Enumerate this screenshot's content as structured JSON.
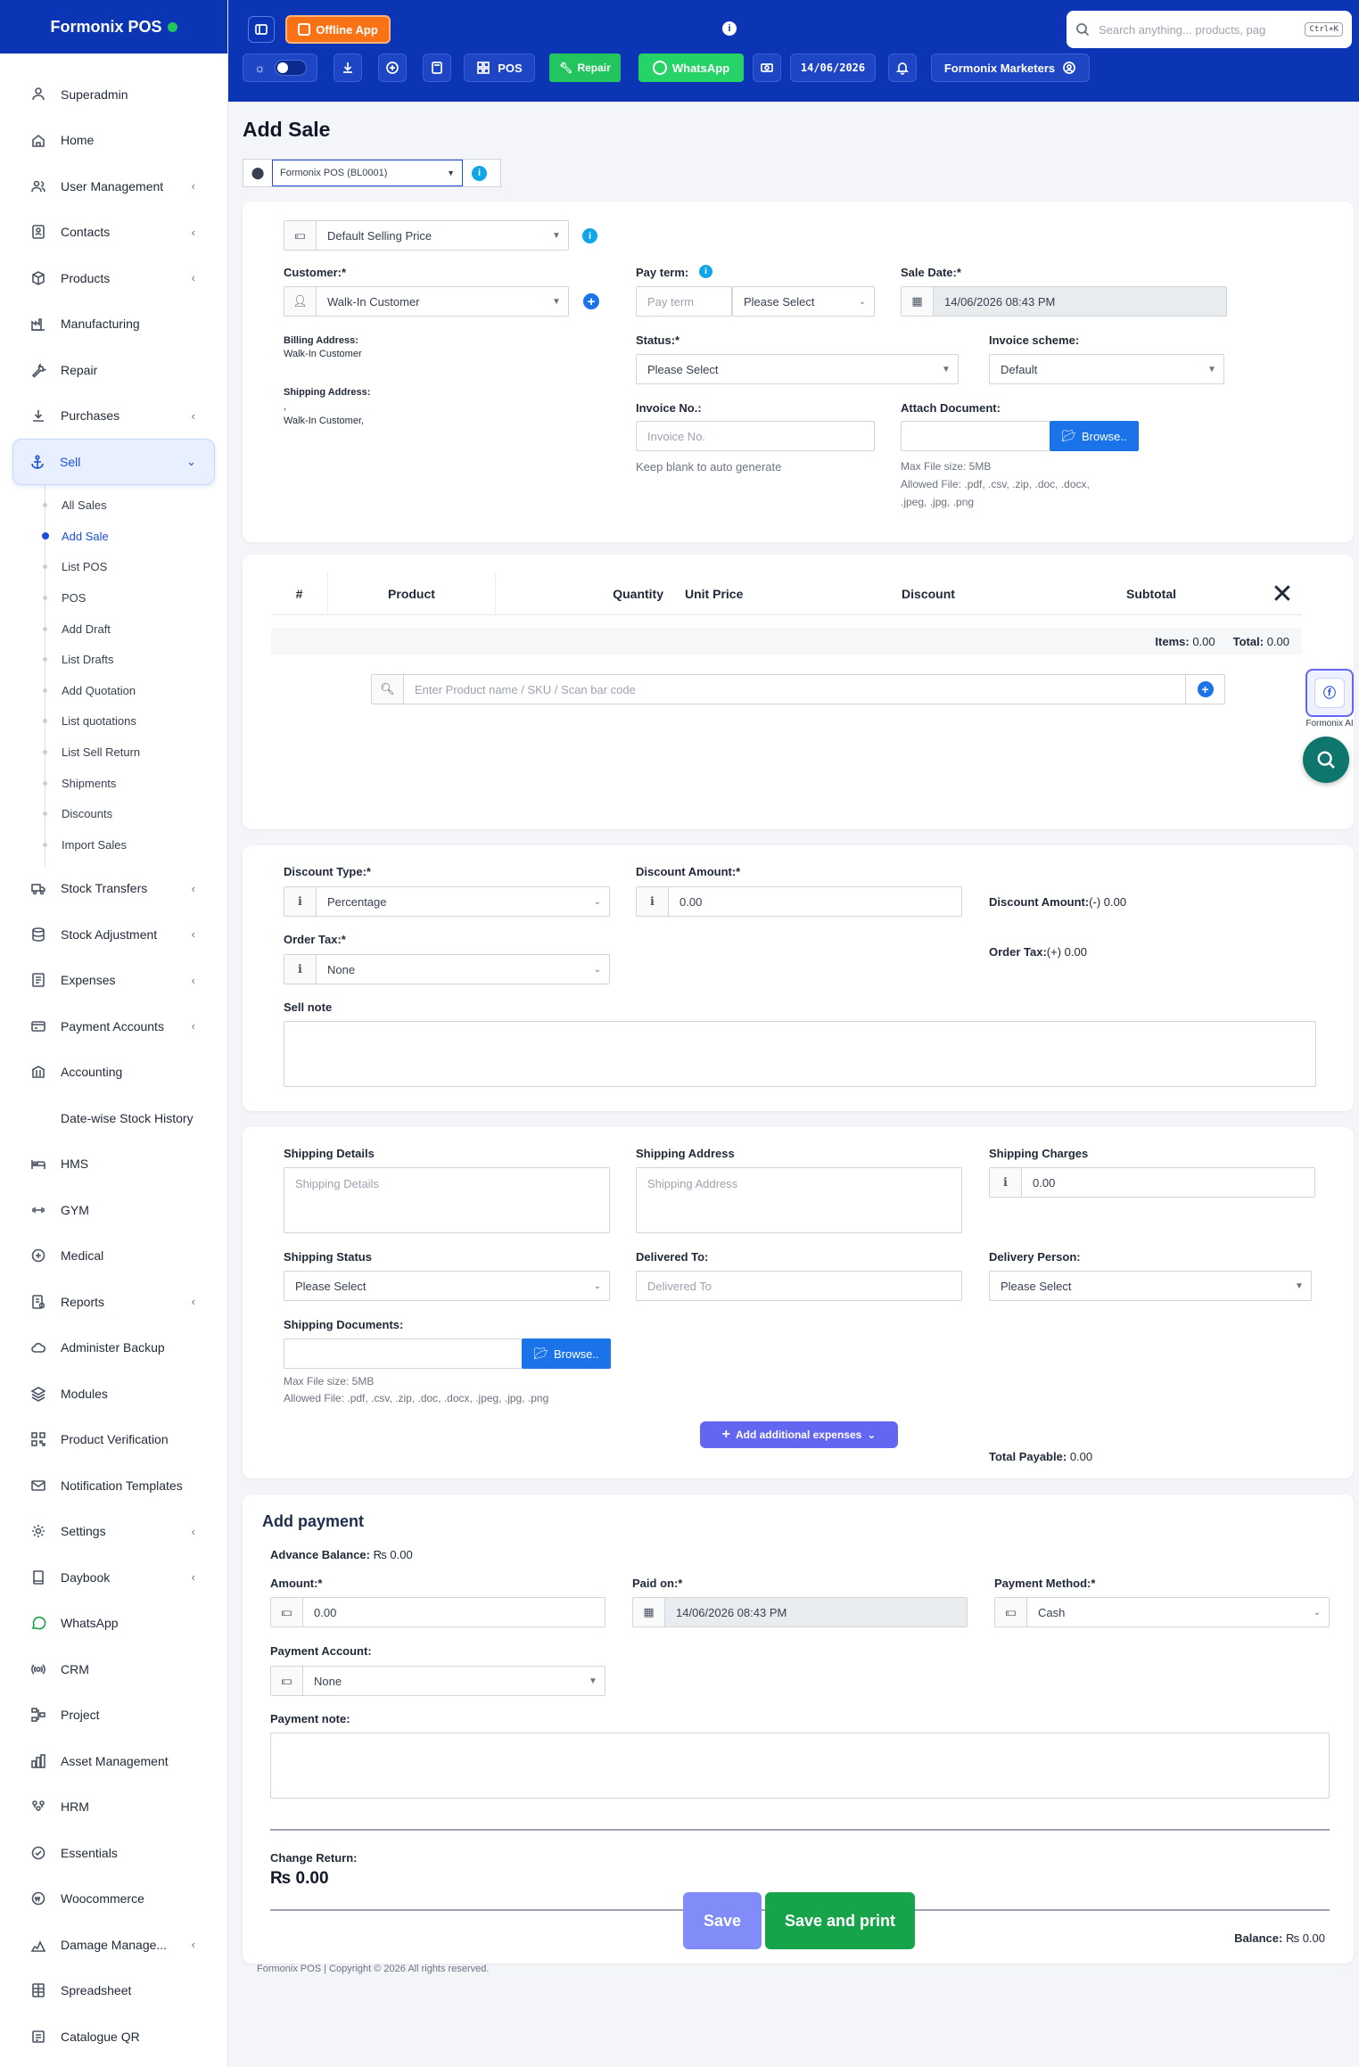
{
  "app": {
    "brand": "Formonix POS"
  },
  "topbar": {
    "offline_label": "Offline App",
    "pos_label": "POS",
    "repair_label": "Repair",
    "whatsapp_label": "WhatsApp",
    "date": "14/06/2026",
    "business": "Formonix Marketers",
    "search_placeholder": "Search anything... products, pag",
    "search_shortcut": "Ctrl+K"
  },
  "sidebar": {
    "items": [
      {
        "label": "Superadmin",
        "icon": "superadmin-icon"
      },
      {
        "label": "Home",
        "icon": "home-icon"
      },
      {
        "label": "User Management",
        "icon": "users-icon",
        "chev": "‹"
      },
      {
        "label": "Contacts",
        "icon": "contacts-icon",
        "chev": "‹"
      },
      {
        "label": "Products",
        "icon": "box-icon",
        "chev": "‹"
      },
      {
        "label": "Manufacturing",
        "icon": "factory-icon"
      },
      {
        "label": "Repair",
        "icon": "wrench-icon"
      },
      {
        "label": "Purchases",
        "icon": "download-icon",
        "chev": "‹"
      },
      {
        "label": "Sell",
        "icon": "anchor-icon",
        "chev": "⌄"
      }
    ],
    "sell_sub": [
      "All Sales",
      "Add Sale",
      "List POS",
      "POS",
      "Add Draft",
      "List Drafts",
      "Add Quotation",
      "List quotations",
      "List Sell Return",
      "Shipments",
      "Discounts",
      "Import Sales"
    ],
    "items2": [
      {
        "label": "Stock Transfers",
        "icon": "truck-icon",
        "chev": "‹"
      },
      {
        "label": "Stock Adjustment",
        "icon": "database-icon",
        "chev": "‹"
      },
      {
        "label": "Expenses",
        "icon": "expenses-icon",
        "chev": "‹"
      },
      {
        "label": "Payment Accounts",
        "icon": "payment-icon",
        "chev": "‹"
      },
      {
        "label": "Accounting",
        "icon": "bank-icon"
      },
      {
        "label": "Date-wise Stock History",
        "icon": ""
      },
      {
        "label": "HMS",
        "icon": "hotel-icon"
      },
      {
        "label": "GYM",
        "icon": "dumbbell-icon"
      },
      {
        "label": "Medical",
        "icon": "medical-icon"
      },
      {
        "label": "Reports",
        "icon": "reports-icon",
        "chev": "‹"
      },
      {
        "label": "Administer Backup",
        "icon": "cloud-icon"
      },
      {
        "label": "Modules",
        "icon": "layers-icon"
      },
      {
        "label": "Product Verification",
        "icon": "qr-icon"
      },
      {
        "label": "Notification Templates",
        "icon": "mail-icon"
      },
      {
        "label": "Settings",
        "icon": "gear-icon",
        "chev": "‹"
      },
      {
        "label": "Daybook",
        "icon": "book-icon",
        "chev": "‹"
      },
      {
        "label": "WhatsApp",
        "icon": "whatsapp-icon"
      },
      {
        "label": "CRM",
        "icon": "crm-icon"
      },
      {
        "label": "Project",
        "icon": "project-icon"
      },
      {
        "label": "Asset Management",
        "icon": "asset-icon"
      },
      {
        "label": "HRM",
        "icon": "hrm-icon"
      },
      {
        "label": "Essentials",
        "icon": "check-icon"
      },
      {
        "label": "Woocommerce",
        "icon": "woo-icon"
      },
      {
        "label": "Damage Manage...",
        "icon": "damage-icon",
        "chev": "‹"
      },
      {
        "label": "Spreadsheet",
        "icon": "sheet-icon"
      },
      {
        "label": "Catalogue QR",
        "icon": "catalogue-icon"
      }
    ]
  },
  "page": {
    "title": "Add Sale",
    "location": "Formonix POS (BL0001)"
  },
  "sale": {
    "price_group": "Default Selling Price",
    "customer_label": "Customer:*",
    "customer": "Walk-In Customer",
    "billing_label": "Billing Address:",
    "billing_value": "Walk-In Customer",
    "shipping_label": "Shipping Address:",
    "shipping_dot": ",",
    "shipping_value": "Walk-In Customer,",
    "pay_term_label": "Pay term:",
    "pay_term_placeholder": "Pay term",
    "pay_term_select": "Please Select",
    "sale_date_label": "Sale Date:*",
    "sale_date": "14/06/2026 08:43 PM",
    "status_label": "Status:*",
    "status": "Please Select",
    "invoice_scheme_label": "Invoice scheme:",
    "invoice_scheme": "Default",
    "invoice_no_label": "Invoice No.:",
    "invoice_no_placeholder": "Invoice No.",
    "invoice_help": "Keep blank to auto generate",
    "attach_label": "Attach Document:",
    "browse": "Browse..",
    "max_size": "Max File size: 5MB",
    "allowed": "Allowed File: .pdf, .csv, .zip, .doc, .docx,",
    "allowed2": ".jpeg, .jpg, .png"
  },
  "products": {
    "columns": [
      "#",
      "Product",
      "Quantity",
      "Unit Price",
      "Discount",
      "Subtotal"
    ],
    "items_label": "Items:",
    "items_value": "0.00",
    "total_label": "Total:",
    "total_value": "0.00",
    "search_placeholder": "Enter Product name / SKU / Scan bar code"
  },
  "discount": {
    "type_label": "Discount Type:*",
    "type": "Percentage",
    "amount_label": "Discount Amount:*",
    "amount": "0.00",
    "summary_label": "Discount Amount:",
    "summary_value": "(-) 0.00",
    "tax_label": "Order Tax:*",
    "tax": "None",
    "tax_summary_label": "Order Tax:",
    "tax_summary_value": "(+) 0.00",
    "note_label": "Sell note"
  },
  "shipping": {
    "details_label": "Shipping Details",
    "details_placeholder": "Shipping Details",
    "address_label": "Shipping Address",
    "address_placeholder": "Shipping Address",
    "charges_label": "Shipping Charges",
    "charges": "0.00",
    "status_label": "Shipping Status",
    "status": "Please Select",
    "delivered_label": "Delivered To:",
    "delivered_placeholder": "Delivered To",
    "person_label": "Delivery Person:",
    "person": "Please Select",
    "docs_label": "Shipping Documents:",
    "browse": "Browse..",
    "max_size": "Max File size: 5MB",
    "allowed": "Allowed File: .pdf, .csv, .zip, .doc, .docx, .jpeg, .jpg, .png",
    "add_expenses": "Add additional expenses",
    "total_label": "Total Payable:",
    "total_value": "0.00"
  },
  "payment": {
    "title": "Add payment",
    "advance_label": "Advance Balance:",
    "advance_value": "₨ 0.00",
    "amount_label": "Amount:*",
    "amount": "0.00",
    "paid_on_label": "Paid on:*",
    "paid_on": "14/06/2026 08:43 PM",
    "method_label": "Payment Method:*",
    "method": "Cash",
    "account_label": "Payment Account:",
    "account": "None",
    "note_label": "Payment note:",
    "change_label": "Change Return:",
    "change_value": "₨ 0.00",
    "balance_label": "Balance:",
    "balance_value": "₨ 0.00"
  },
  "actions": {
    "save": "Save",
    "save_print": "Save and print"
  },
  "footer": {
    "copyright": "Formonix POS | Copyright © 2026 All rights reserved."
  },
  "ai": {
    "label": "Formonix AI"
  },
  "colors": {
    "primary": "#0b35b5",
    "offline": "#f97316",
    "repair": "#22c55e",
    "whatsapp": "#25d366",
    "save": "#818cf8",
    "save_print": "#16a34a"
  }
}
